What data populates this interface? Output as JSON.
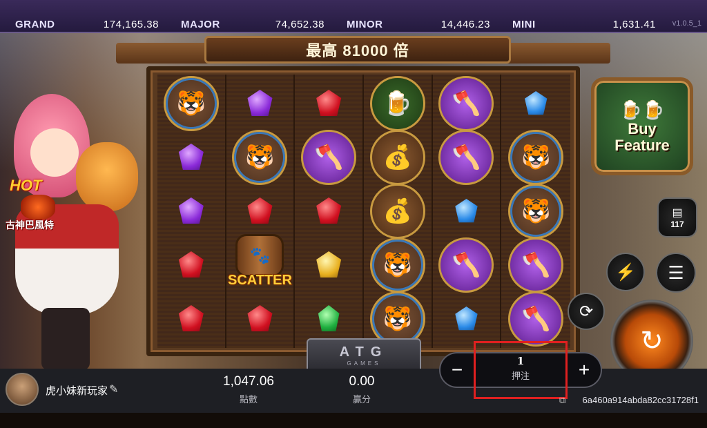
{
  "jackpots": [
    {
      "label": "GRAND",
      "value": "174,165.38"
    },
    {
      "label": "MAJOR",
      "value": "74,652.38"
    },
    {
      "label": "MINOR",
      "value": "14,446.23"
    },
    {
      "label": "MINI",
      "value": "1,631.41"
    }
  ],
  "version": "v1.0.5_1",
  "header": {
    "max_win": "最高 81000 倍"
  },
  "hot_badge": {
    "hot": "HOT",
    "name": "古神巴風特"
  },
  "reels": [
    [
      "mask-medal",
      "purple-gem",
      "purple-gem",
      "red-gem",
      "red-gem"
    ],
    [
      "purple-gem",
      "mask-medal",
      "red-gem",
      "scatter",
      "red-gem"
    ],
    [
      "red-gem",
      "axe-medal",
      "red-gem",
      "yellow-gem",
      "green-gem"
    ],
    [
      "mug-medal",
      "gold-sack-medal",
      "gold-sack-medal",
      "mask-medal",
      "mask-medal"
    ],
    [
      "axe-medal",
      "axe-medal",
      "blue-gem",
      "axe-medal",
      "blue-gem"
    ],
    [
      "blue-gem",
      "mask-medal",
      "mask-medal",
      "axe-medal",
      "axe-medal"
    ]
  ],
  "scatter_label": "SCATTER",
  "buy_feature": {
    "label_line1": "Buy",
    "label_line2": "Feature"
  },
  "history": {
    "count": "117"
  },
  "logo": {
    "main": "ATG",
    "sub": "GAMES"
  },
  "player": {
    "name": "虎小妹新玩家"
  },
  "balance": {
    "value": "1,047.06",
    "label": "點數"
  },
  "win": {
    "value": "0.00",
    "label": "贏分"
  },
  "bet": {
    "value": "1",
    "label": "押注",
    "minus": "−",
    "plus": "+"
  },
  "session_id": "6a460a914abda82cc31728f1",
  "colors": {
    "highlight": "#e02020",
    "jackpot_bar": "#2e2248",
    "buy_feature_bg": "#2f5a2c"
  }
}
